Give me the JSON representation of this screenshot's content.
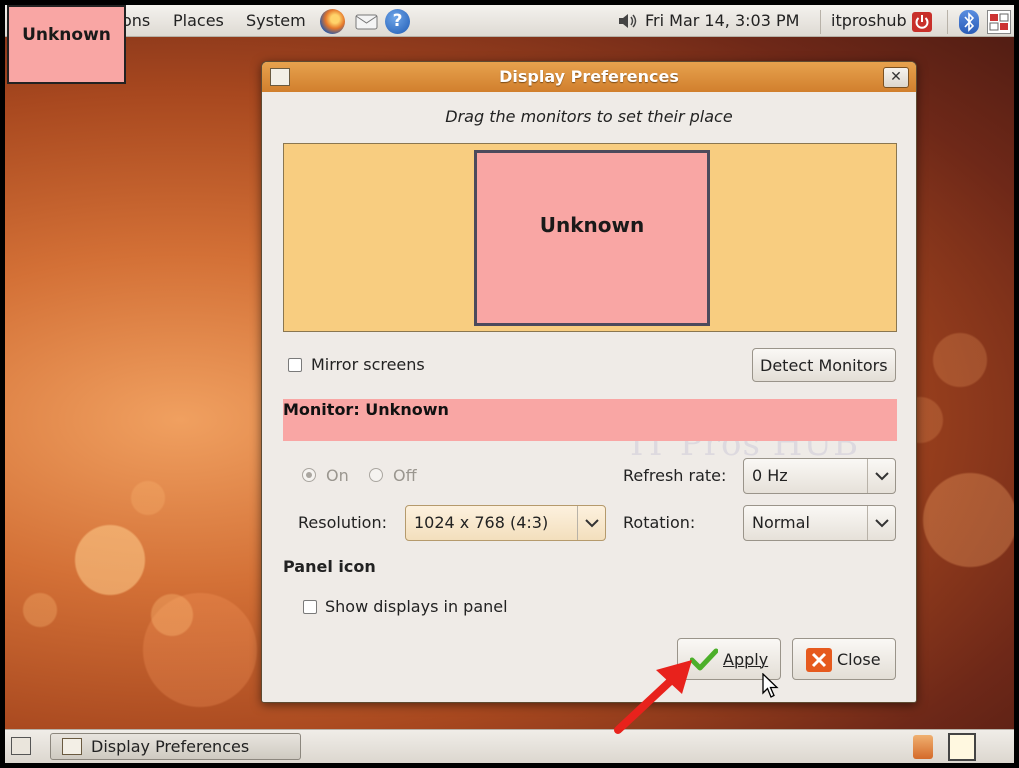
{
  "top_panel": {
    "menu_applications_partial": "ons",
    "menu_places": "Places",
    "menu_system": "System",
    "clock": "Fri Mar 14,  3:03 PM",
    "user": "itproshub",
    "help_glyph": "?"
  },
  "desktop": {
    "monitor_label": "Unknown"
  },
  "window": {
    "title": "Display Preferences",
    "close_glyph": "✕",
    "instruction": "Drag the monitors to set their place",
    "monitor_box_label": "Unknown",
    "mirror_screens_label": "Mirror screens",
    "detect_monitors_label": "Detect Monitors",
    "watermark": "IT Pros HUB",
    "monitor_info": "Monitor: Unknown",
    "on_label": "On",
    "off_label": "Off",
    "on_selected": true,
    "refresh_rate_label": "Refresh rate:",
    "refresh_rate_value": "0 Hz",
    "resolution_label": "Resolution:",
    "resolution_value": "1024 x 768 (4:3)",
    "rotation_label": "Rotation:",
    "rotation_value": "Normal",
    "panel_icon_heading": "Panel icon",
    "show_displays_label": "Show displays in panel",
    "apply_label": "Apply",
    "close_label": "Close"
  },
  "bottom_panel": {
    "taskbar_item": "Display Preferences"
  },
  "colors": {
    "monitor_pink": "#f9a6a4",
    "canvas_yellow": "#f8cd80",
    "titlebar_orange": "#d17f2d",
    "annotation_arrow": "#e8221c"
  }
}
